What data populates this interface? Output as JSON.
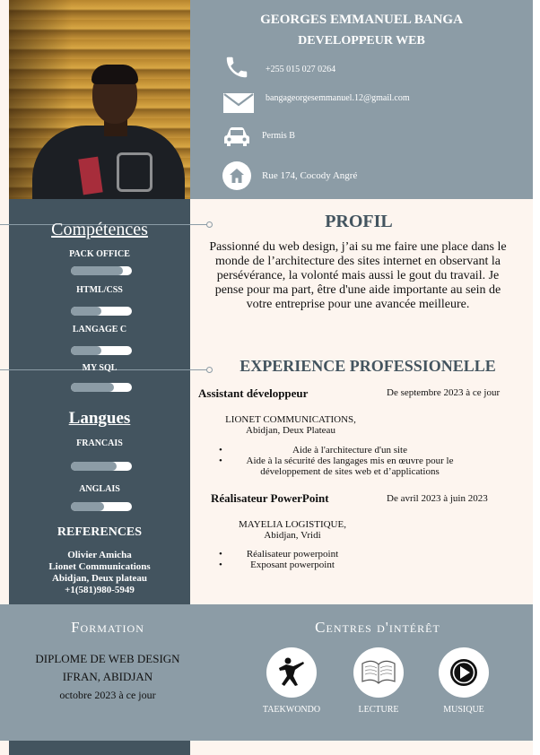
{
  "header": {
    "name": "GEORGES EMMANUEL BANGA",
    "job_title": "DEVELOPPEUR WEB",
    "contacts": [
      {
        "icon": "phone-icon",
        "text": "+255 015 027 0264"
      },
      {
        "icon": "mail-icon",
        "text": "bangageorgesemmanuel.12@gmail.com"
      },
      {
        "icon": "car-icon",
        "text": "Permis B"
      },
      {
        "icon": "home-icon",
        "text": "Rue 174, Cocody Angré"
      }
    ]
  },
  "skills": {
    "title": "Compétences",
    "items": [
      {
        "label": "PACK OFFICE",
        "level": 0.85
      },
      {
        "label": "HTML/CSS",
        "level": 0.5
      },
      {
        "label": "LANGAGE C",
        "level": 0.5
      },
      {
        "label": "MY SQL",
        "level": 0.7
      }
    ]
  },
  "languages": {
    "title": "Langues",
    "items": [
      {
        "label": "FRANCAIS",
        "level": 0.75
      },
      {
        "label": "ANGLAIS",
        "level": 0.55
      }
    ]
  },
  "references": {
    "title": "REFERENCES",
    "lines": [
      "Olivier Amicha",
      "Lionet Communications",
      "Abidjan, Deux plateau",
      "+1(581)980-5949"
    ]
  },
  "profile": {
    "title": "PROFIL",
    "text": "Passionné du web design, j’ai su me faire une place dans le monde de l’architecture des sites internet en observant la persévérance, la volonté mais aussi le gout du travail. Je pense pour ma part, être d'une aide importante au sein de votre entreprise pour une avancée meilleure."
  },
  "experience": {
    "title": "EXPERIENCE PROFESSIONELLE",
    "jobs": [
      {
        "title": "Assistant développeur",
        "date": "De septembre 2023 à ce jour",
        "company": "LIONET COMMUNICATIONS,",
        "location": "Abidjan, Deux Plateau",
        "bullets": [
          "Aide à l'architecture d'un site",
          "Aide à la sécurité des langages mis en œuvre pour le développement de sites web et d’applications"
        ]
      },
      {
        "title": "Réalisateur PowerPoint",
        "date": "De avril 2023 à juin 2023",
        "company": "MAYELIA LOGISTIQUE,",
        "location": "Abidjan, Vridi",
        "bullets": [
          "Réalisateur powerpoint",
          "Exposant powerpoint"
        ]
      }
    ]
  },
  "formation": {
    "title": "Formation",
    "lines": [
      "DIPLOME DE WEB DESIGN",
      "IFRAN, ABIDJAN",
      "octobre 2023 à ce jour"
    ]
  },
  "interests": {
    "title": "Centres d'intérêt",
    "items": [
      {
        "icon": "taekwondo-icon",
        "label": "TAEKWONDO"
      },
      {
        "icon": "book-icon",
        "label": "LECTURE"
      },
      {
        "icon": "play-icon",
        "label": "MUSIQUE"
      }
    ]
  },
  "colors": {
    "dark": "#43545f",
    "grey": "#8c9ca6",
    "cream": "#fdf5ef"
  }
}
